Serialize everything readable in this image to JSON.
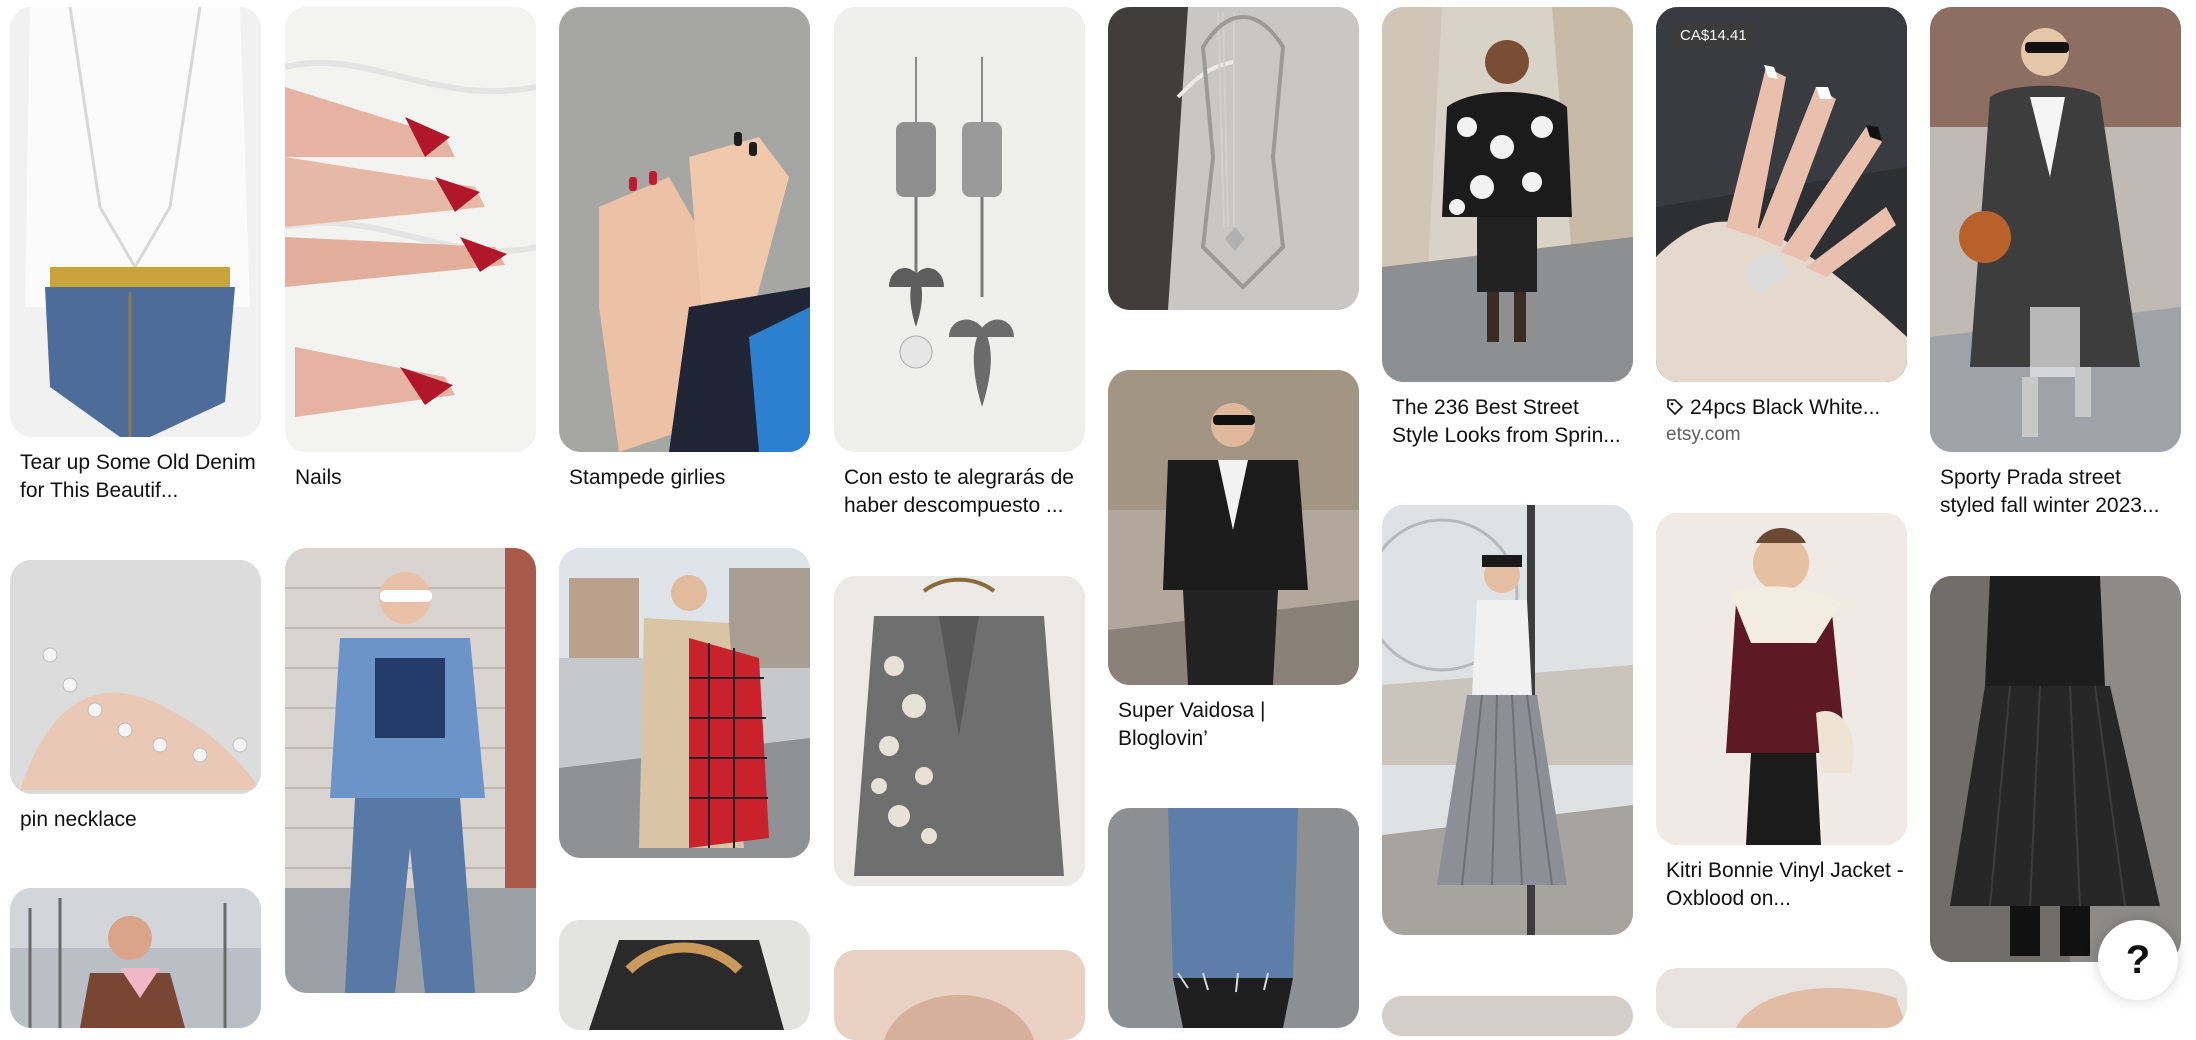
{
  "colors": {
    "text": "#111111",
    "subtle": "#5f5f5f",
    "background": "#ffffff"
  },
  "pins": {
    "denim": {
      "title": "Tear up Some Old Denim for This Beautif..."
    },
    "nails": {
      "title": "Nails"
    },
    "stampede": {
      "title": "Stampede girlies"
    },
    "earrings": {
      "title": "Con esto te alegrarás de haber descompuesto ..."
    },
    "street236": {
      "title": "The 236 Best Street Style Looks from Sprin..."
    },
    "etsy": {
      "price": "CA$14.41",
      "title": "24pcs Black White...",
      "source": "etsy.com"
    },
    "prada": {
      "title": "Sporty Prada street styled fall winter 2023..."
    },
    "pin_necklace": {
      "title": "pin necklace"
    },
    "vaidosa": {
      "title": "Super Vaidosa | Bloglovin’"
    },
    "kitri": {
      "title": "Kitri Bonnie Vinyl Jacket - Oxblood on..."
    }
  },
  "help": {
    "label": "?"
  }
}
